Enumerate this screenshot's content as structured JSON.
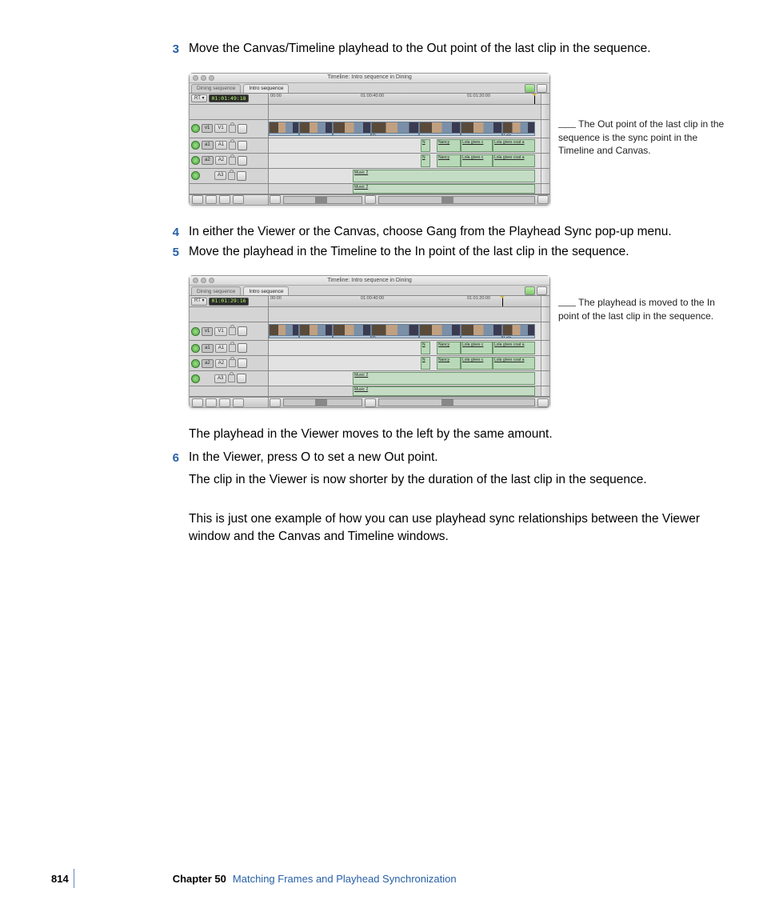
{
  "steps": {
    "s3": {
      "num": "3",
      "text": "Move the Canvas/Timeline playhead to the Out point of the last clip in the sequence."
    },
    "s4": {
      "num": "4",
      "text": "In either the Viewer or the Canvas, choose Gang from the Playhead Sync pop-up menu."
    },
    "s5": {
      "num": "5",
      "text": "Move the playhead in the Timeline to the In point of the last clip in the sequence."
    },
    "s6": {
      "num": "6",
      "text": "In the Viewer, press O to set a new Out point."
    }
  },
  "paragraphs": {
    "p_after_fig2": "The playhead in the Viewer moves to the left by the same amount.",
    "p_after_s6": "The clip in the Viewer is now shorter by the duration of the last clip in the sequence.",
    "p_closing": "This is just one example of how you can use playhead sync relationships between the Viewer window and the Canvas and Timeline windows."
  },
  "callouts": {
    "c1": "The Out point of the last clip in the sequence is the sync point in the Timeline and Canvas.",
    "c2": "The playhead is moved to the In point of the last clip in the sequence."
  },
  "timeline": {
    "title": "Timeline: Intro sequence in Dining",
    "tabs": {
      "inactive": "Dining sequence",
      "active": "Intro sequence"
    },
    "rt_label": "RT ▾",
    "tc1": "01:01:49:18",
    "tc2": "01:01:29:16",
    "ticks": {
      "t0": "00:00",
      "t1": "01:00:40:00",
      "t2": "01:01:20:00"
    },
    "tracks": {
      "v1_src": "v1",
      "v1_dst": "V1",
      "a1_src": "a1",
      "a1_dst": "A1",
      "a2_src": "a2",
      "a2_dst": "A2",
      "a3": "A3"
    },
    "clips": {
      "video_last": "Lola",
      "video_d": "D",
      "nancy": "Nancy",
      "lola_gives_c": "Lola gives c",
      "lola_gives_coat": "Lola gives coat a",
      "music2": "Music 2",
      "n_short": "N"
    }
  },
  "footer": {
    "page": "814",
    "chapter_label": "Chapter 50",
    "chapter_title": "Matching Frames and Playhead Synchronization"
  }
}
